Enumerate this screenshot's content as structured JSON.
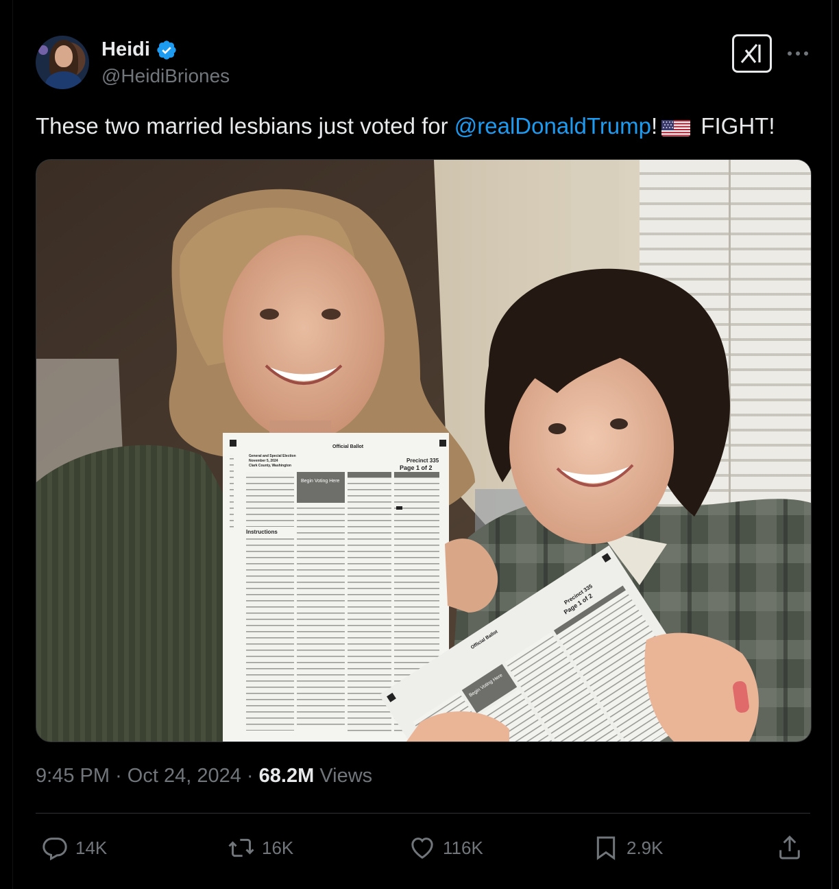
{
  "author": {
    "display_name": "Heidi",
    "handle": "@HeidiBriones",
    "verified_icon": "verified-badge-icon",
    "verified_color": "#1d9bf0"
  },
  "header": {
    "grok_icon": "grok-icon",
    "more_icon": "more-options-icon"
  },
  "tweet": {
    "text_before": "These two married lesbians just voted for ",
    "mention": "@realDonaldTrump",
    "text_after_mention": "!",
    "flag_icon": "us-flag-emoji",
    "text_end": " FIGHT!"
  },
  "media": {
    "kind": "photo",
    "ballot_title": "Official Ballot",
    "ballot_precinct": "Precinct 335",
    "ballot_page": "Page 1 of 2",
    "ballot_election": "General and Special Election",
    "ballot_date": "November 5, 2024",
    "ballot_county": "Clark County, Washington",
    "ballot_begin": "Begin Voting Here",
    "ballot_instructions": "Instructions"
  },
  "meta": {
    "time": "9:45 PM",
    "separator": "·",
    "date": "Oct 24, 2024",
    "views_count": "68.2M",
    "views_label": "Views"
  },
  "actions": {
    "replies": "14K",
    "reposts": "16K",
    "likes": "116K",
    "bookmarks": "2.9K"
  },
  "colors": {
    "background": "#000000",
    "text": "#e7e9ea",
    "muted": "#71767b",
    "link": "#1d9bf0",
    "border": "#2f3336"
  }
}
